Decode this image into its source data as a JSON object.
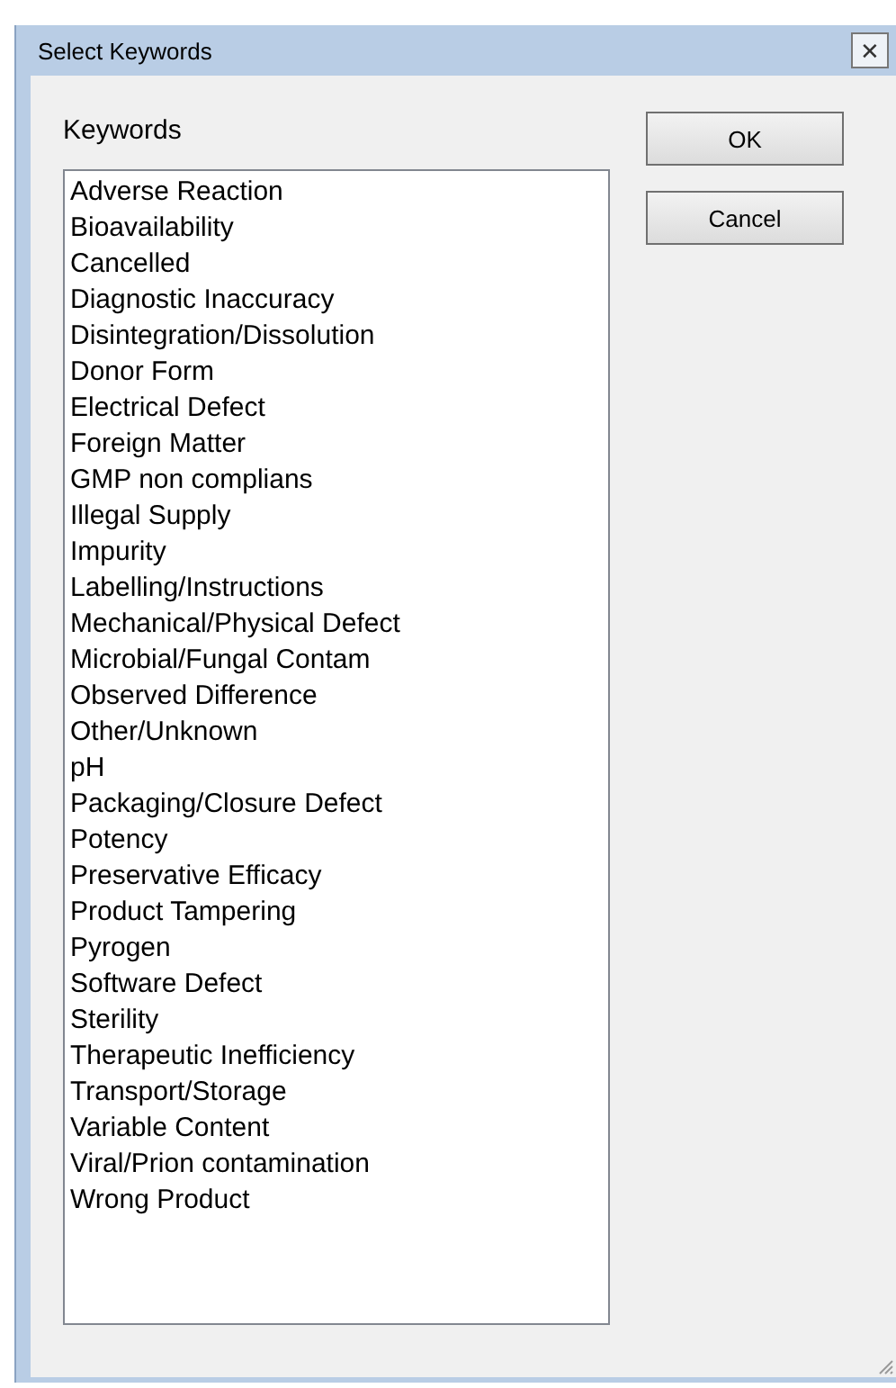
{
  "window": {
    "title": "Select Keywords",
    "close": "✕"
  },
  "keywords": {
    "label": "Keywords",
    "items": [
      {
        "text": "Adverse Reaction",
        "selected": false
      },
      {
        "text": "Bioavailability",
        "selected": false
      },
      {
        "text": "Cancelled",
        "selected": false
      },
      {
        "text": "Diagnostic Inaccuracy",
        "selected": false
      },
      {
        "text": "Disintegration/Dissolution",
        "selected": false
      },
      {
        "text": "Donor Form",
        "selected": false
      },
      {
        "text": "Electrical Defect",
        "selected": false
      },
      {
        "text": "Foreign Matter",
        "selected": false
      },
      {
        "text": "GMP non complians",
        "selected": false
      },
      {
        "text": "Illegal Supply",
        "selected": false
      },
      {
        "text": "Impurity",
        "selected": false
      },
      {
        "text": "Labelling/Instructions",
        "selected": false
      },
      {
        "text": "Mechanical/Physical Defect",
        "selected": false
      },
      {
        "text": "Microbial/Fungal Contam",
        "selected": false
      },
      {
        "text": "Observed Difference",
        "selected": false
      },
      {
        "text": "Other/Unknown",
        "selected": false
      },
      {
        "text": "pH",
        "selected": false
      },
      {
        "text": "Packaging/Closure Defect",
        "selected": false
      },
      {
        "text": "Potency",
        "selected": false
      },
      {
        "text": "Preservative Efficacy",
        "selected": false
      },
      {
        "text": "Product Tampering",
        "selected": false
      },
      {
        "text": "Pyrogen",
        "selected": false
      },
      {
        "text": "Software Defect",
        "selected": false
      },
      {
        "text": "Sterility",
        "selected": false
      },
      {
        "text": "Therapeutic Inefficiency",
        "selected": false
      },
      {
        "text": "Transport/Storage",
        "selected": false
      },
      {
        "text": "Variable Content",
        "selected": false
      },
      {
        "text": "Viral/Prion contamination",
        "selected": false
      },
      {
        "text": "Wrong Product",
        "selected": false
      }
    ]
  },
  "buttons": [
    "OK",
    "Cancel"
  ]
}
